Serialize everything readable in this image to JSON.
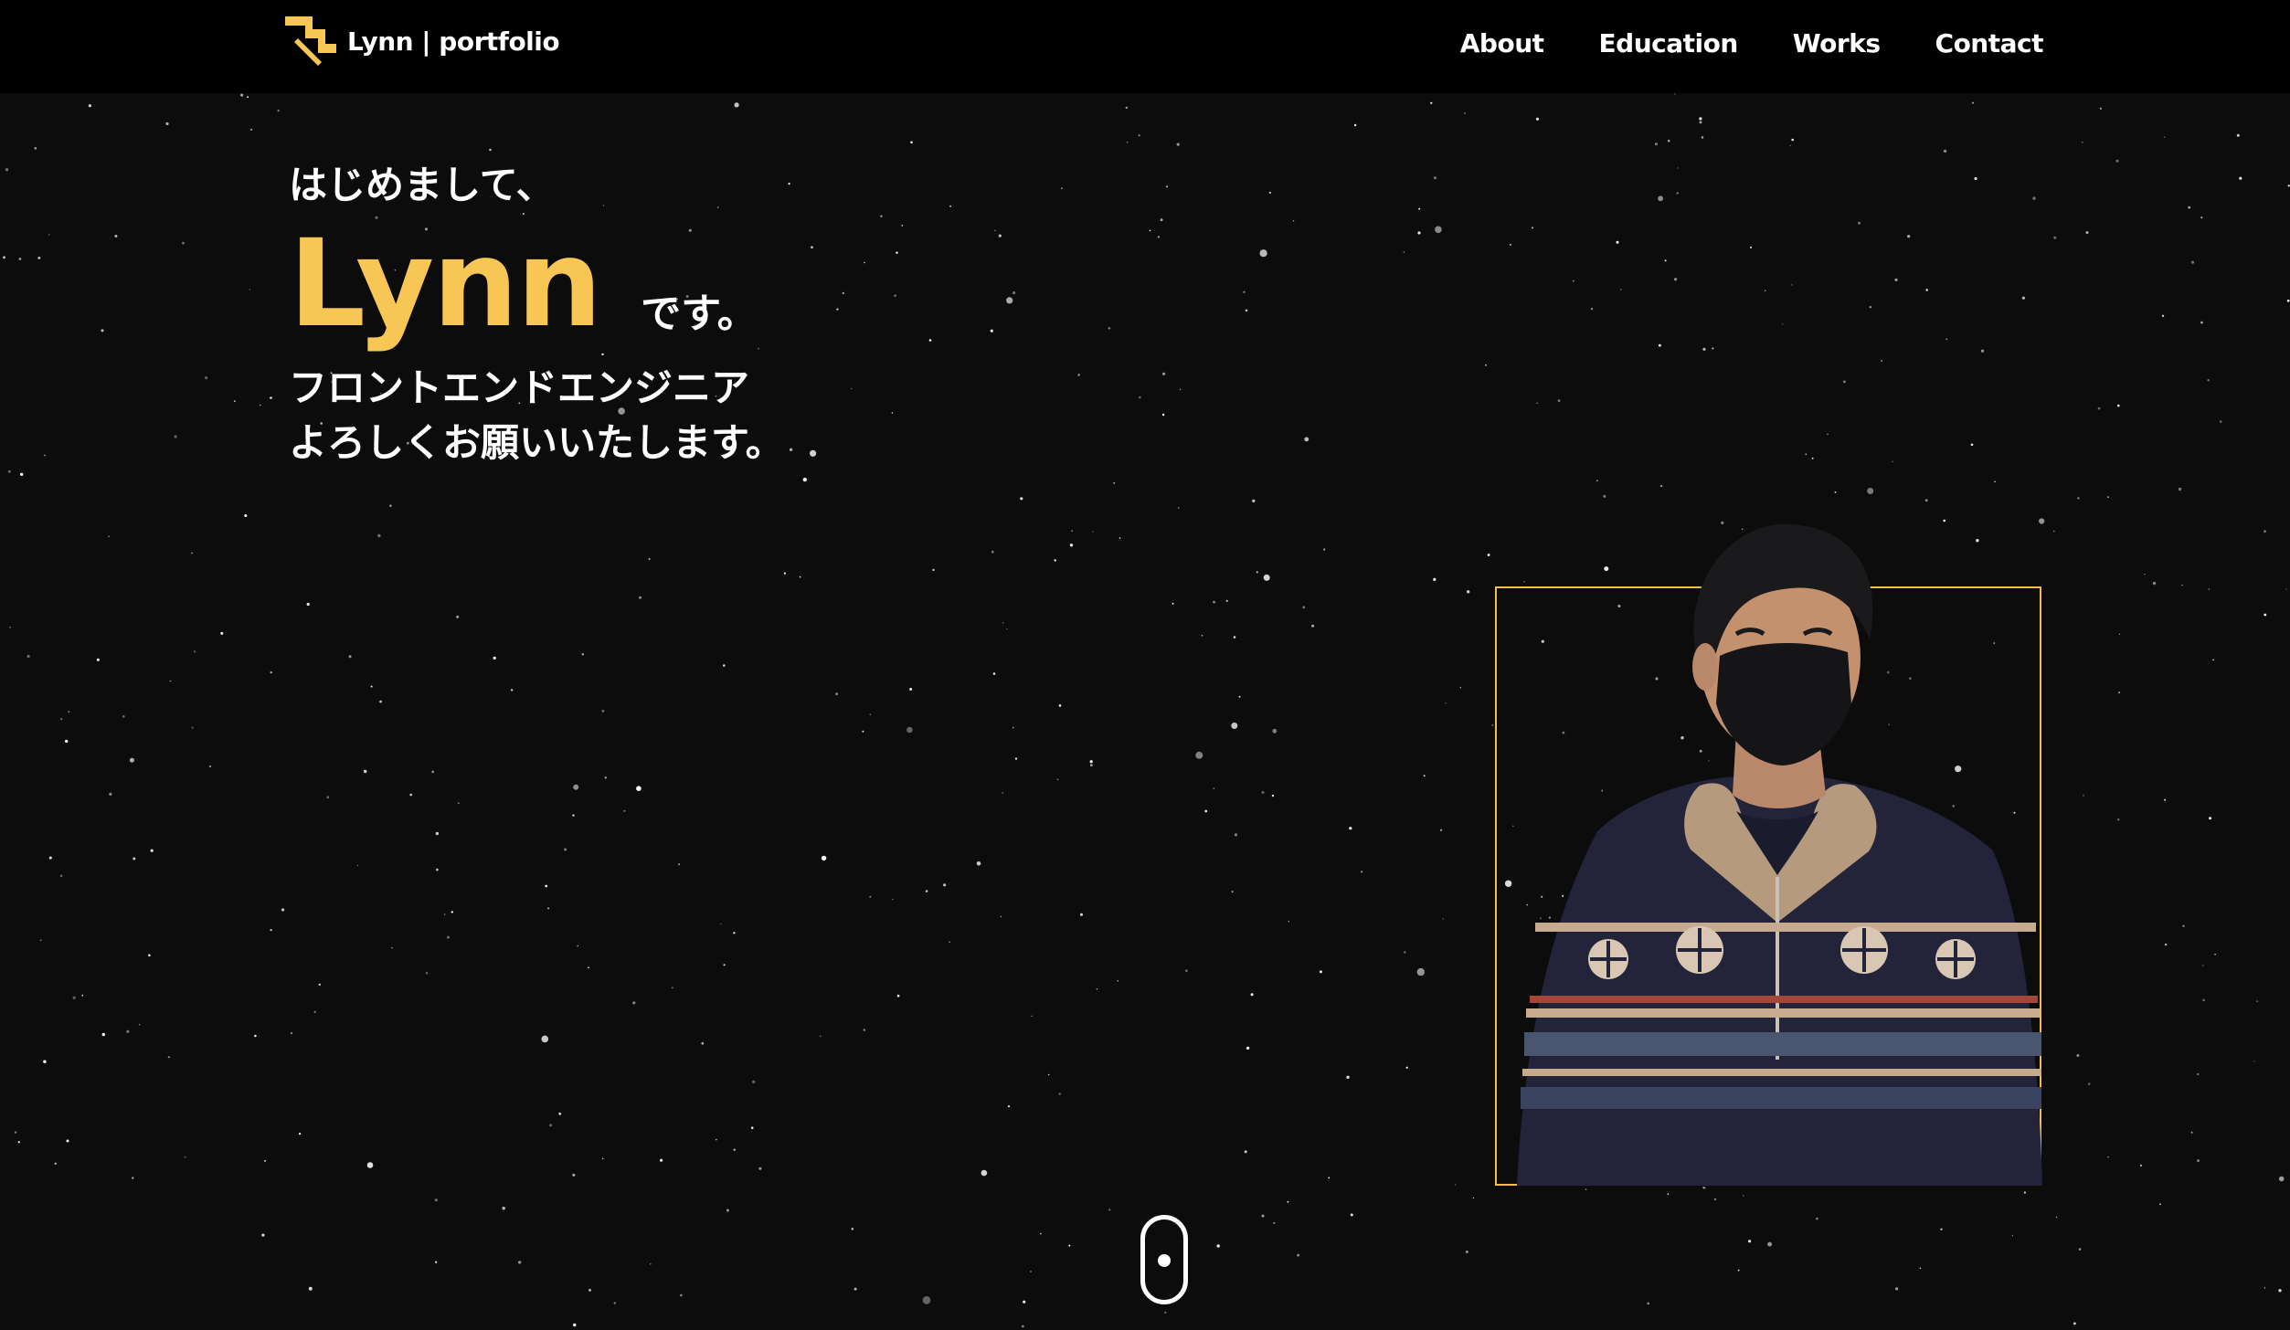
{
  "header": {
    "brand": {
      "logo_icon": "stair-step-logo-icon",
      "text": "Lynn | portfolio"
    },
    "nav": [
      {
        "label": "About"
      },
      {
        "label": "Education"
      },
      {
        "label": "Works"
      },
      {
        "label": "Contact"
      }
    ]
  },
  "hero": {
    "greeting": "はじめまして、",
    "name": "Lynn",
    "name_suffix": "です。",
    "role": "フロントエンドエンジニア",
    "regards": "よろしくお願いいたします。"
  },
  "portrait": {
    "alt": "portrait photo"
  },
  "scroll_indicator": {
    "icon": "mouse-scroll-icon"
  },
  "colors": {
    "background": "#0c0c0c",
    "header_background": "#000000",
    "accent": "#f7c654",
    "frame": "#f2bd48",
    "text": "#ffffff"
  }
}
